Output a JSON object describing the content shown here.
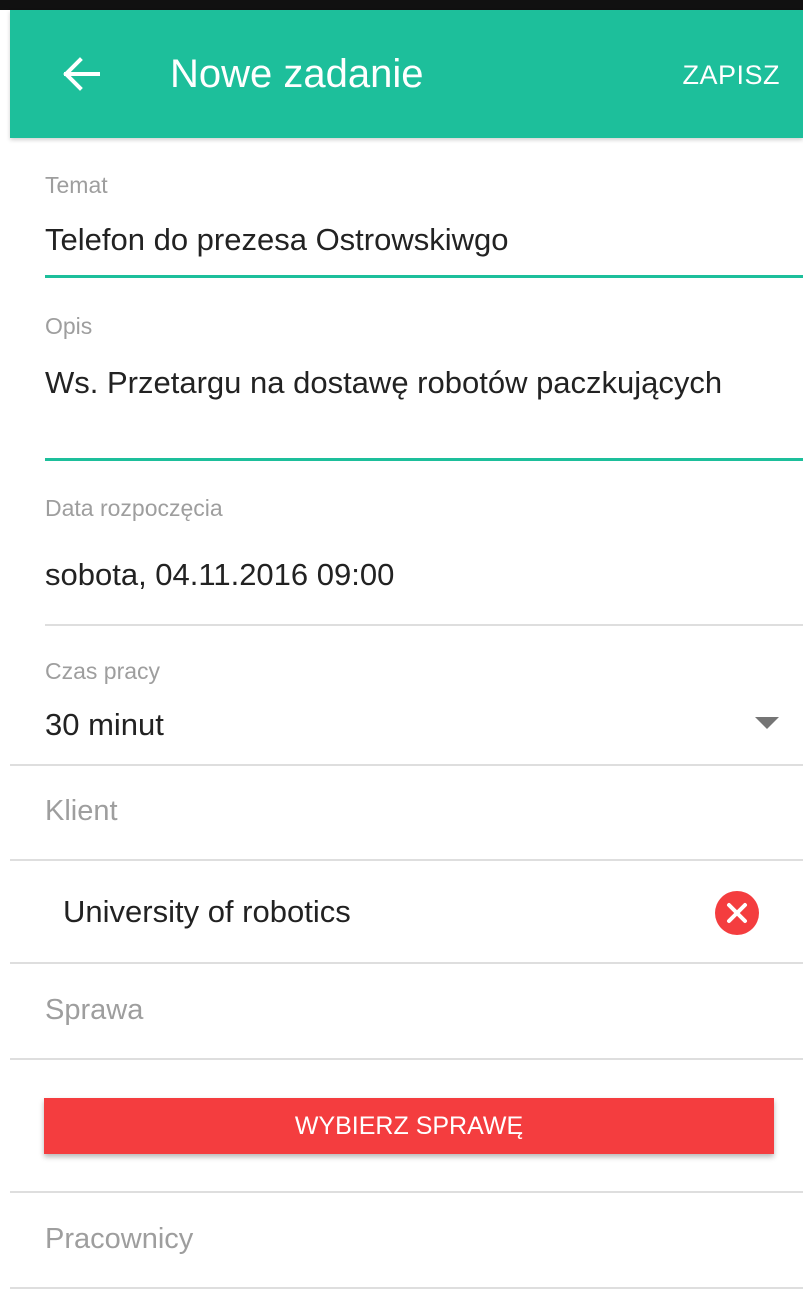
{
  "appbar": {
    "title": "Nowe zadanie",
    "save_label": "ZAPISZ",
    "color": "#1dbf9b"
  },
  "fields": {
    "subject": {
      "label": "Temat",
      "value": "Telefon do prezesa Ostrowskiwgo"
    },
    "description": {
      "label": "Opis",
      "value": "Ws. Przetargu na dostawę robotów paczkujących"
    },
    "start_date": {
      "label": "Data rozpoczęcia",
      "value": "sobota, 04.11.2016 09:00"
    },
    "work_time": {
      "label": "Czas pracy",
      "value": "30 minut"
    }
  },
  "client": {
    "label": "Klient",
    "selected": "University of robotics"
  },
  "matter": {
    "label": "Sprawa",
    "button_label": "WYBIERZ SPRAWĘ",
    "button_color": "#f43d3f"
  },
  "employees": {
    "label": "Pracownicy"
  },
  "icons": {
    "back": "arrow-left",
    "dropdown": "triangle-down",
    "remove": "close-circle"
  }
}
